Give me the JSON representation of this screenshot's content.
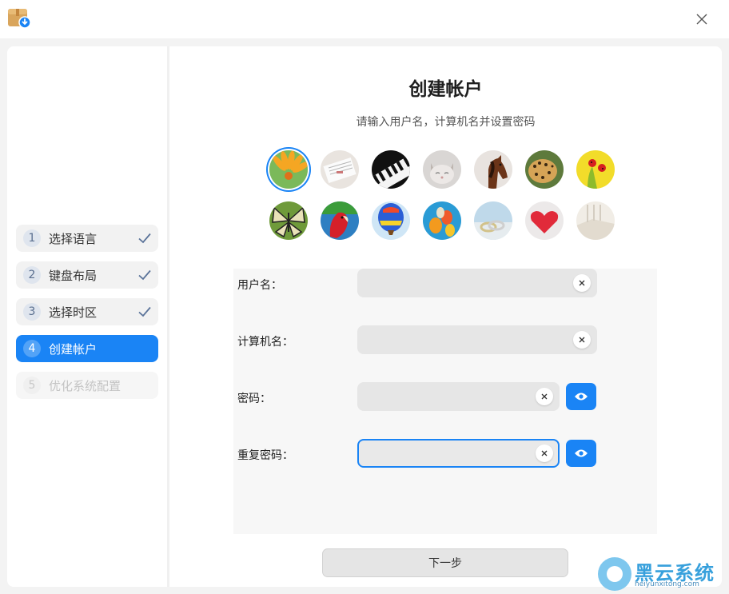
{
  "window": {
    "app_icon": "package-download-icon",
    "close_icon": "close-icon"
  },
  "steps": [
    {
      "number": "1",
      "label": "选择语言",
      "state": "done"
    },
    {
      "number": "2",
      "label": "键盘布局",
      "state": "done"
    },
    {
      "number": "3",
      "label": "选择时区",
      "state": "done"
    },
    {
      "number": "4",
      "label": "创建帐户",
      "state": "active"
    },
    {
      "number": "5",
      "label": "优化系统配置",
      "state": "disabled"
    }
  ],
  "main": {
    "title": "创建帐户",
    "subtitle": "请输入用户名，计算机名并设置密码"
  },
  "avatars": [
    {
      "name": "flower-avatar",
      "selected": true
    },
    {
      "name": "notebook-avatar",
      "selected": false
    },
    {
      "name": "piano-avatar",
      "selected": false
    },
    {
      "name": "kitten-avatar",
      "selected": false
    },
    {
      "name": "horse-avatar",
      "selected": false
    },
    {
      "name": "leopard-avatar",
      "selected": false
    },
    {
      "name": "ladybug-avatar",
      "selected": false
    },
    {
      "name": "butterfly-avatar",
      "selected": false
    },
    {
      "name": "parrot-avatar",
      "selected": false
    },
    {
      "name": "hot-air-balloon-avatar",
      "selected": false
    },
    {
      "name": "balloons-avatar",
      "selected": false
    },
    {
      "name": "rings-avatar",
      "selected": false
    },
    {
      "name": "heart-avatar",
      "selected": false
    },
    {
      "name": "room-avatar",
      "selected": false
    }
  ],
  "form": {
    "username_label": "用户名：",
    "username_value": "",
    "computer_name_label": "计算机名：",
    "computer_name_value": "",
    "password_label": "密码：",
    "password_value": "",
    "repeat_password_label": "重复密码：",
    "repeat_password_value": ""
  },
  "next_button": "下一步",
  "watermark": {
    "text": "黑云系统",
    "url_text": "heiyunxitong.com"
  },
  "colors": {
    "accent": "#1a84f5",
    "background": "#f3f3f3",
    "panel": "#ffffff"
  }
}
